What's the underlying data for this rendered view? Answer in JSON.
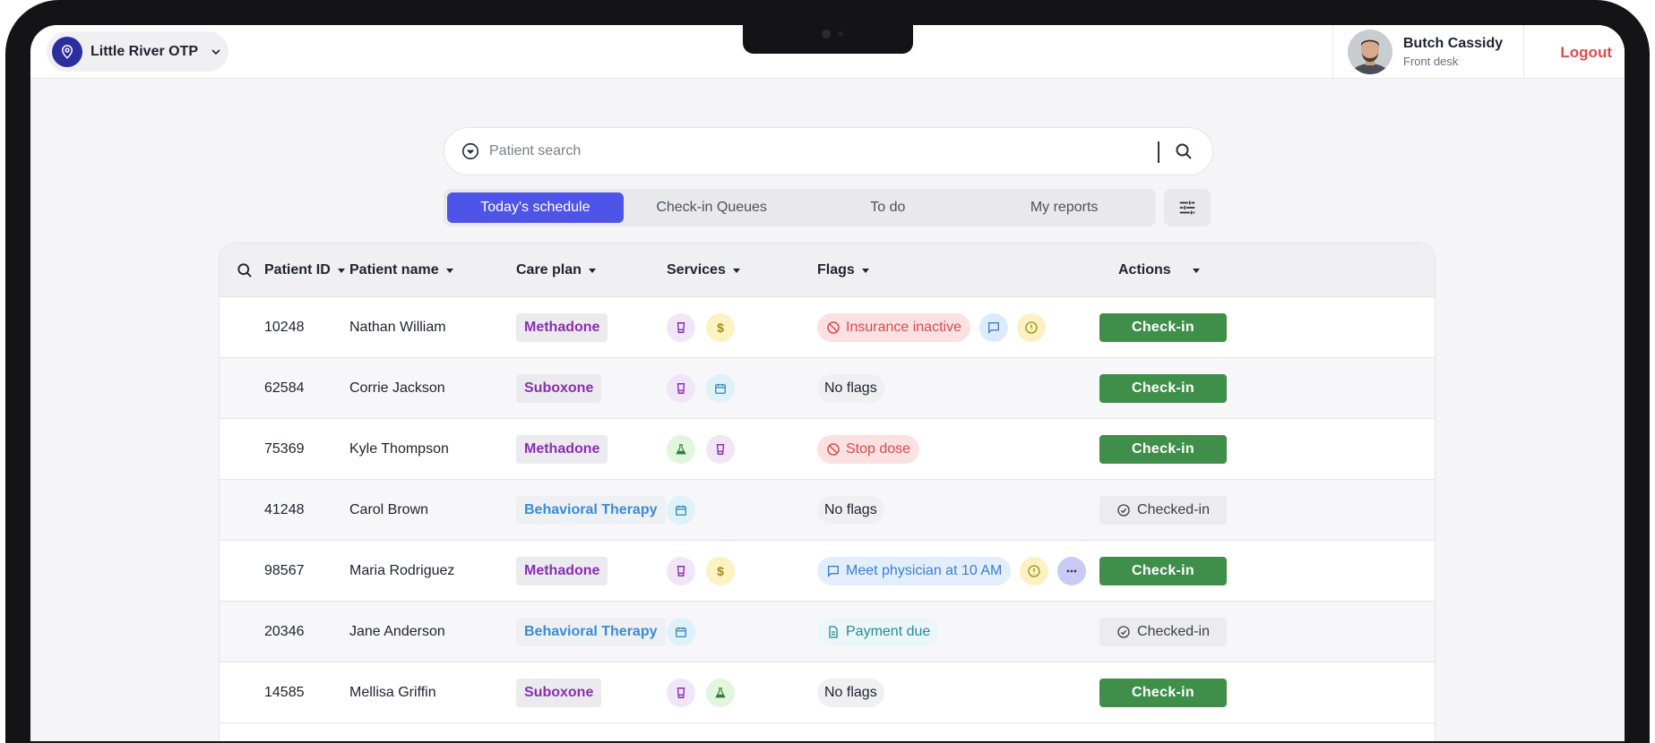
{
  "location": {
    "name": "Little River OTP"
  },
  "user": {
    "name": "Butch Cassidy",
    "role": "Front desk",
    "logout_label": "Logout"
  },
  "search": {
    "placeholder": "Patient search",
    "value": ""
  },
  "tabs": [
    {
      "label": "Today's schedule",
      "active": true
    },
    {
      "label": "Check-in Queues",
      "active": false
    },
    {
      "label": "To do",
      "active": false
    },
    {
      "label": "My reports",
      "active": false
    }
  ],
  "table": {
    "headers": {
      "patient_id": "Patient ID",
      "patient_name": "Patient name",
      "care_plan": "Care plan",
      "services": "Services",
      "flags": "Flags",
      "actions": "Actions"
    },
    "rows": [
      {
        "id": "10248",
        "name": "Nathan William",
        "plan": "Methadone",
        "plan_color": "purple",
        "services": [
          "cup-icon",
          "dollar-icon"
        ],
        "flags": [
          {
            "type": "red",
            "icon": "ban-icon",
            "label": "Insurance inactive"
          }
        ],
        "extra_icons": [
          "message-icon",
          "warning-icon"
        ],
        "action": "Check-in",
        "checked_in": false
      },
      {
        "id": "62584",
        "name": "Corrie Jackson",
        "plan": "Suboxone",
        "plan_color": "purple",
        "services": [
          "cup-icon",
          "calendar-icon"
        ],
        "flags": [
          {
            "type": "none",
            "label": "No flags"
          }
        ],
        "extra_icons": [],
        "action": "Check-in",
        "checked_in": false
      },
      {
        "id": "75369",
        "name": "Kyle Thompson",
        "plan": "Methadone",
        "plan_color": "purple",
        "services": [
          "flask-icon",
          "cup-icon"
        ],
        "flags": [
          {
            "type": "red",
            "icon": "ban-icon",
            "label": "Stop dose"
          }
        ],
        "extra_icons": [],
        "action": "Check-in",
        "checked_in": false
      },
      {
        "id": "41248",
        "name": "Carol Brown",
        "plan": "Behavioral Therapy",
        "plan_color": "blue",
        "services": [
          "calendar-icon"
        ],
        "flags": [
          {
            "type": "none",
            "label": "No flags"
          }
        ],
        "extra_icons": [],
        "action": "Checked-in",
        "checked_in": true
      },
      {
        "id": "98567",
        "name": "Maria Rodriguez",
        "plan": "Methadone",
        "plan_color": "purple",
        "services": [
          "cup-icon",
          "dollar-icon"
        ],
        "flags": [
          {
            "type": "msg",
            "icon": "message-icon",
            "label": "Meet physician at 10 AM"
          }
        ],
        "extra_icons": [
          "warning-icon",
          "more-icon"
        ],
        "action": "Check-in",
        "checked_in": false
      },
      {
        "id": "20346",
        "name": "Jane Anderson",
        "plan": "Behavioral Therapy",
        "plan_color": "blue",
        "services": [
          "calendar-icon"
        ],
        "flags": [
          {
            "type": "pay",
            "icon": "document-icon",
            "label": "Payment due"
          }
        ],
        "extra_icons": [],
        "action": "Checked-in",
        "checked_in": true
      },
      {
        "id": "14585",
        "name": "Mellisa Griffin",
        "plan": "Suboxone",
        "plan_color": "purple",
        "services": [
          "cup-icon",
          "flask-icon"
        ],
        "flags": [
          {
            "type": "none",
            "label": "No flags"
          }
        ],
        "extra_icons": [],
        "action": "Check-in",
        "checked_in": false
      }
    ]
  },
  "colors": {
    "accent": "#4f54e8",
    "checkin": "#3f8f4a",
    "logout": "#e04b4b",
    "plan_purple": "#8a2fb0",
    "plan_blue": "#3a8bd6"
  }
}
